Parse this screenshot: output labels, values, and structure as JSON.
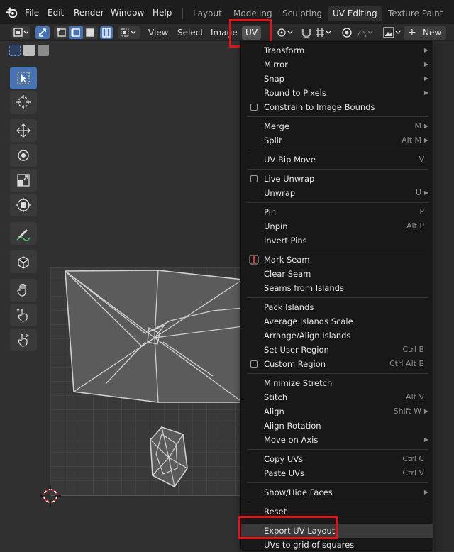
{
  "topbar": {
    "menus": [
      "File",
      "Edit",
      "Render",
      "Window",
      "Help"
    ],
    "workspaces": [
      {
        "label": "Layout",
        "active": false
      },
      {
        "label": "Modeling",
        "active": false
      },
      {
        "label": "Sculpting",
        "active": false
      },
      {
        "label": "UV Editing",
        "active": true
      },
      {
        "label": "Texture Paint",
        "active": false
      }
    ]
  },
  "header": {
    "view": "View",
    "select": "Select",
    "image": "Image",
    "uv": "UV",
    "new": "New"
  },
  "menu": {
    "items": [
      {
        "label": "Transform",
        "shortcut": "",
        "submenu": true,
        "check": false
      },
      {
        "label": "Mirror",
        "shortcut": "",
        "submenu": true,
        "check": false
      },
      {
        "label": "Snap",
        "shortcut": "",
        "submenu": true,
        "check": false
      },
      {
        "label": "Round to Pixels",
        "shortcut": "",
        "submenu": true,
        "check": false
      },
      {
        "label": "Constrain to Image Bounds",
        "shortcut": "",
        "submenu": false,
        "check": true
      },
      {
        "sep": true
      },
      {
        "label": "Merge",
        "shortcut": "M",
        "submenu": true,
        "check": false
      },
      {
        "label": "Split",
        "shortcut": "Alt M",
        "submenu": true,
        "check": false
      },
      {
        "sep": true
      },
      {
        "label": "UV Rip Move",
        "shortcut": "V",
        "submenu": false,
        "check": false
      },
      {
        "sep": true
      },
      {
        "label": "Live Unwrap",
        "shortcut": "",
        "submenu": false,
        "check": true
      },
      {
        "label": "Unwrap",
        "shortcut": "U",
        "submenu": true,
        "check": false
      },
      {
        "sep": true
      },
      {
        "label": "Pin",
        "shortcut": "P",
        "submenu": false,
        "check": false
      },
      {
        "label": "Unpin",
        "shortcut": "Alt P",
        "submenu": false,
        "check": false
      },
      {
        "label": "Invert Pins",
        "shortcut": "",
        "submenu": false,
        "check": false
      },
      {
        "sep": true
      },
      {
        "label": "Mark Seam",
        "shortcut": "",
        "submenu": false,
        "check": false,
        "seam": true
      },
      {
        "label": "Clear Seam",
        "shortcut": "",
        "submenu": false,
        "check": false
      },
      {
        "label": "Seams from Islands",
        "shortcut": "",
        "submenu": false,
        "check": false
      },
      {
        "sep": true
      },
      {
        "label": "Pack Islands",
        "shortcut": "",
        "submenu": false,
        "check": false
      },
      {
        "label": "Average Islands Scale",
        "shortcut": "",
        "submenu": false,
        "check": false
      },
      {
        "label": "Arrange/Align Islands",
        "shortcut": "",
        "submenu": false,
        "check": false
      },
      {
        "label": "Set User Region",
        "shortcut": "Ctrl B",
        "submenu": false,
        "check": false
      },
      {
        "label": "Custom Region",
        "shortcut": "Ctrl Alt B",
        "submenu": false,
        "check": true
      },
      {
        "sep": true
      },
      {
        "label": "Minimize Stretch",
        "shortcut": "",
        "submenu": false,
        "check": false
      },
      {
        "label": "Stitch",
        "shortcut": "Alt V",
        "submenu": false,
        "check": false
      },
      {
        "label": "Align",
        "shortcut": "Shift W",
        "submenu": true,
        "check": false
      },
      {
        "label": "Align Rotation",
        "shortcut": "",
        "submenu": false,
        "check": false
      },
      {
        "label": "Move on Axis",
        "shortcut": "",
        "submenu": true,
        "check": false
      },
      {
        "sep": true
      },
      {
        "label": "Copy UVs",
        "shortcut": "Ctrl C",
        "submenu": false,
        "check": false
      },
      {
        "label": "Paste UVs",
        "shortcut": "Ctrl V",
        "submenu": false,
        "check": false
      },
      {
        "sep": true
      },
      {
        "label": "Show/Hide Faces",
        "shortcut": "",
        "submenu": true,
        "check": false
      },
      {
        "sep": true
      },
      {
        "label": "Reset",
        "shortcut": "",
        "submenu": false,
        "check": false
      },
      {
        "sep": true
      },
      {
        "label": "Export UV Layout",
        "shortcut": "",
        "submenu": false,
        "check": false,
        "highlight": true
      },
      {
        "label": "UVs to grid of squares",
        "shortcut": "",
        "submenu": false,
        "check": false
      }
    ]
  },
  "colors": {
    "accent": "#4772b3",
    "callout": "#e0141c",
    "menu_bg": "#181818"
  }
}
